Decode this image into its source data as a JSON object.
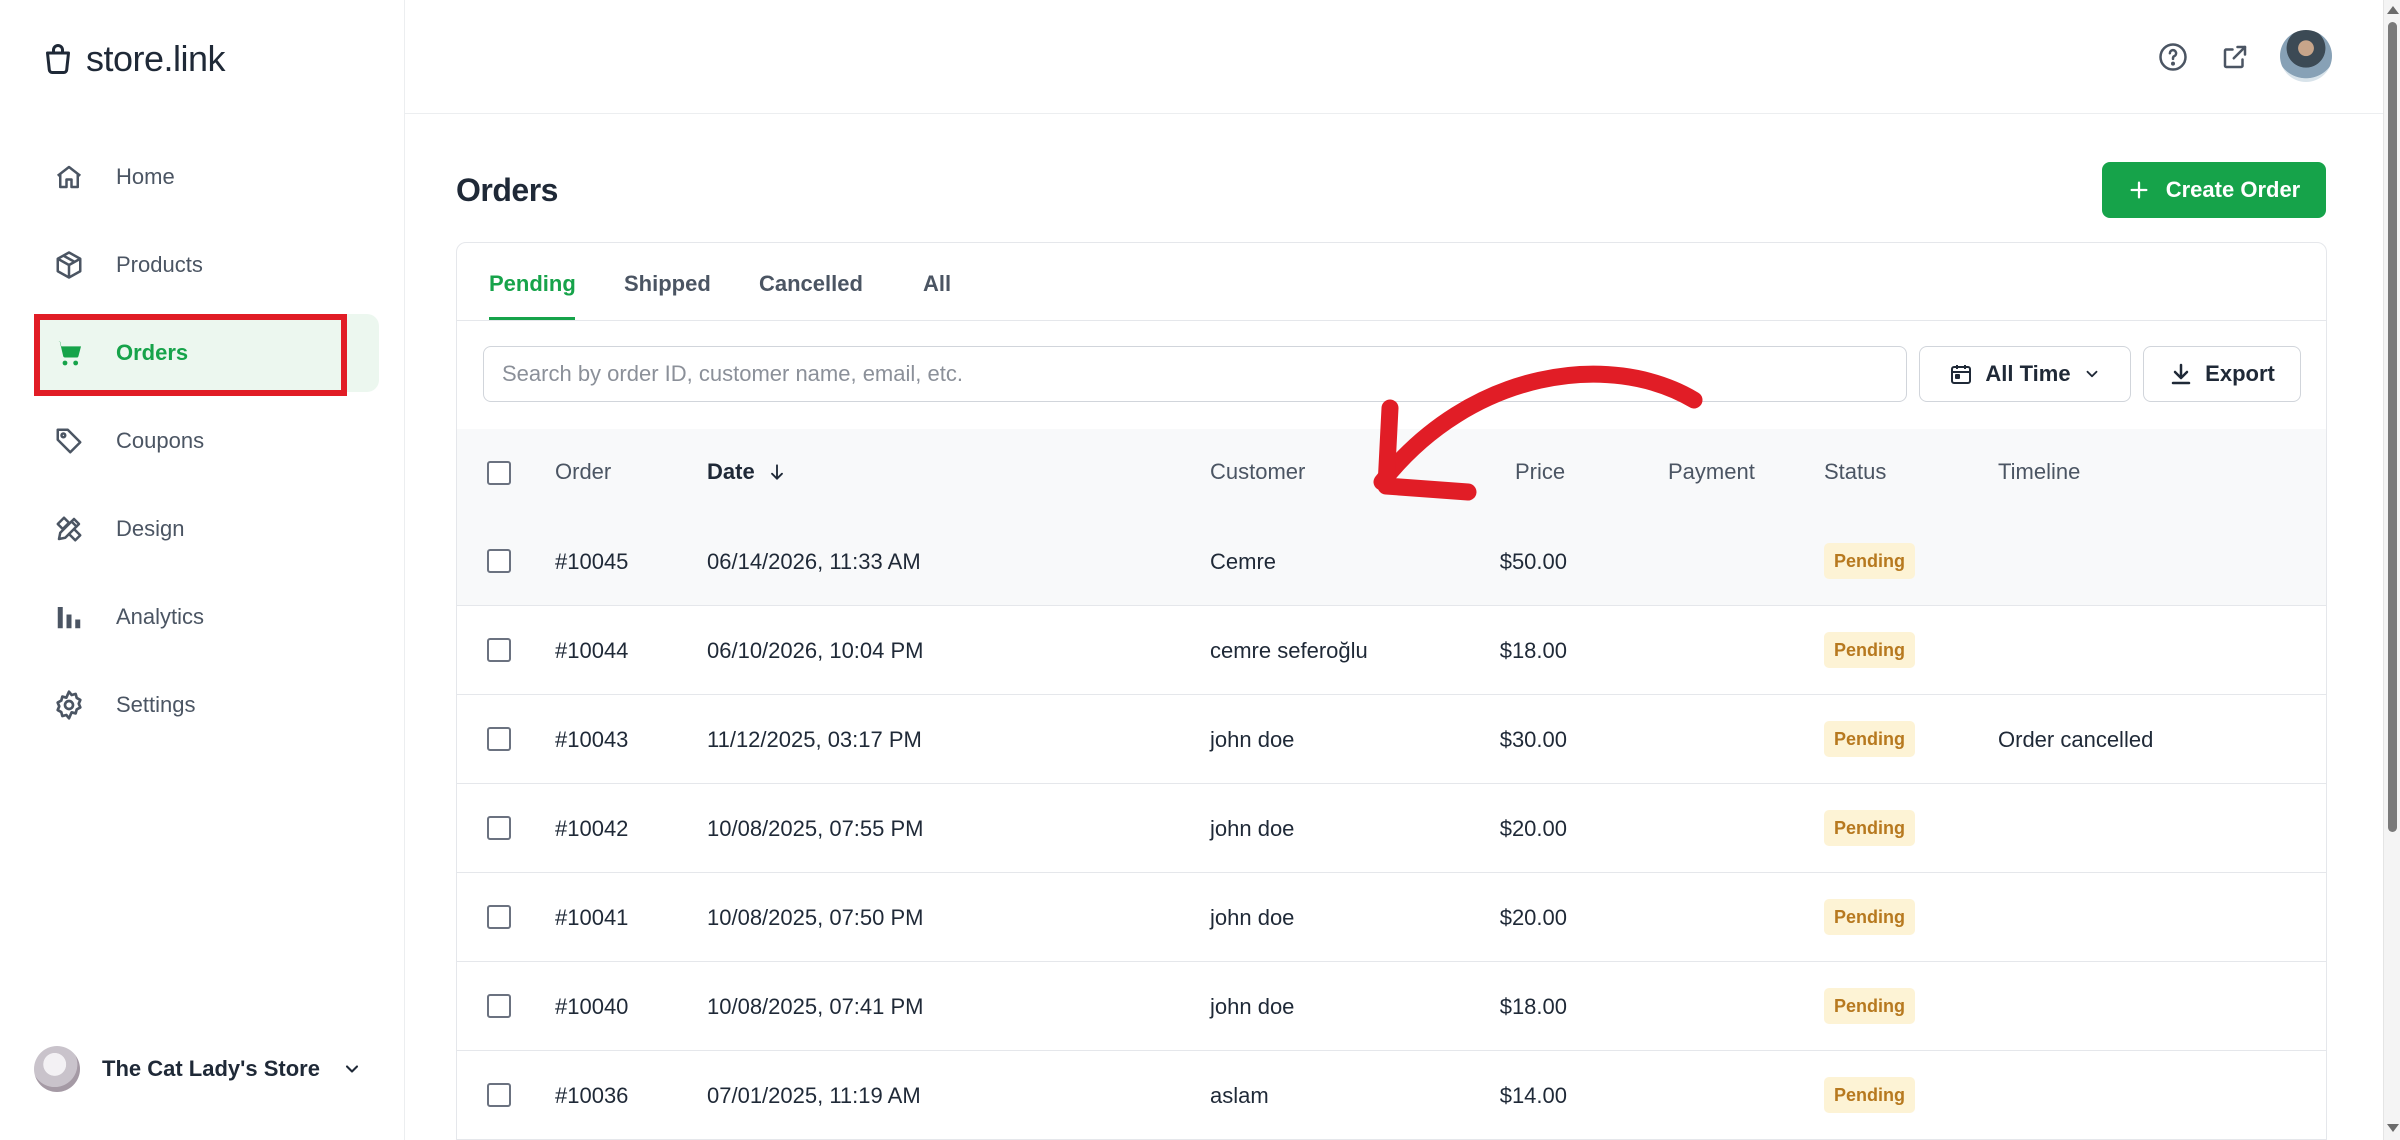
{
  "brand": {
    "name": "store.link"
  },
  "sidebar": {
    "items": [
      {
        "label": "Home",
        "icon": "home-icon"
      },
      {
        "label": "Products",
        "icon": "box-icon"
      },
      {
        "label": "Orders",
        "icon": "cart-icon",
        "active": true
      },
      {
        "label": "Coupons",
        "icon": "tag-icon"
      },
      {
        "label": "Design",
        "icon": "design-tools-icon"
      },
      {
        "label": "Analytics",
        "icon": "bar-chart-icon"
      },
      {
        "label": "Settings",
        "icon": "gear-icon"
      }
    ],
    "store": {
      "name": "The Cat Lady's Store"
    }
  },
  "topbar": {
    "icons": [
      "help-icon",
      "external-link-icon",
      "user-avatar"
    ]
  },
  "main": {
    "title": "Orders",
    "create_button": "Create Order",
    "tabs": [
      {
        "label": "Pending",
        "active": true
      },
      {
        "label": "Shipped"
      },
      {
        "label": "Cancelled"
      },
      {
        "label": "All"
      }
    ],
    "search_placeholder": "Search by order ID, customer name, email, etc.",
    "date_filter": "All Time",
    "export_button": "Export",
    "columns": [
      "Order",
      "Date",
      "Customer",
      "Price",
      "Payment",
      "Status",
      "Timeline"
    ],
    "rows": [
      {
        "order": "#10045",
        "date": "06/14/2026, 11:33 AM",
        "customer": "Cemre",
        "price": "$50.00",
        "payment": "",
        "status": "Pending",
        "timeline": ""
      },
      {
        "order": "#10044",
        "date": "06/10/2026, 10:04 PM",
        "customer": "cemre seferoğlu",
        "price": "$18.00",
        "payment": "",
        "status": "Pending",
        "timeline": ""
      },
      {
        "order": "#10043",
        "date": "11/12/2025, 03:17 PM",
        "customer": "john doe",
        "price": "$30.00",
        "payment": "",
        "status": "Pending",
        "timeline": "Order cancelled"
      },
      {
        "order": "#10042",
        "date": "10/08/2025, 07:55 PM",
        "customer": "john doe",
        "price": "$20.00",
        "payment": "",
        "status": "Pending",
        "timeline": ""
      },
      {
        "order": "#10041",
        "date": "10/08/2025, 07:50 PM",
        "customer": "john doe",
        "price": "$20.00",
        "payment": "",
        "status": "Pending",
        "timeline": ""
      },
      {
        "order": "#10040",
        "date": "10/08/2025, 07:41 PM",
        "customer": "john doe",
        "price": "$18.00",
        "payment": "",
        "status": "Pending",
        "timeline": ""
      },
      {
        "order": "#10036",
        "date": "07/01/2025, 11:19 AM",
        "customer": "aslam",
        "price": "$14.00",
        "payment": "",
        "status": "Pending",
        "timeline": ""
      }
    ]
  },
  "colors": {
    "accent": "#16a34a",
    "annotation": "#e11d26",
    "pending_bg": "#fdf3d5",
    "pending_text": "#b7791f"
  }
}
